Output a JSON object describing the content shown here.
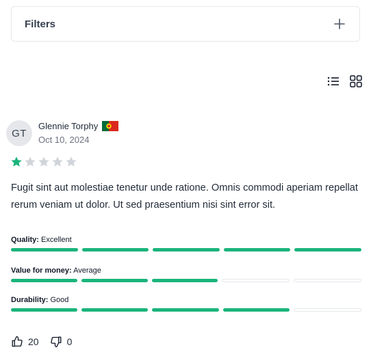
{
  "filters": {
    "label": "Filters",
    "toggle_icon": "plus-icon"
  },
  "view": {
    "list_icon": "list-view-icon",
    "grid_icon": "grid-view-icon"
  },
  "review": {
    "avatar_initials": "GT",
    "author": "Glennie Torphy",
    "country_flag": "portugal-flag-icon",
    "date": "Oct 10, 2024",
    "rating": 1,
    "rating_max": 5,
    "text": "Fugit sint aut molestiae tenetur unde ratione. Omnis commodi aperiam repellat rerum veniam ut dolor. Ut sed praesentium nisi sint error sit.",
    "attributes": [
      {
        "name": "Quality:",
        "value": "Excellent",
        "score": 5,
        "max": 5
      },
      {
        "name": "Value for money:",
        "value": "Average",
        "score": 3,
        "max": 5
      },
      {
        "name": "Durability:",
        "value": "Good",
        "score": 4,
        "max": 5
      }
    ],
    "helpful_count": "20",
    "unhelpful_count": "0"
  },
  "colors": {
    "accent": "#1ab47b",
    "star_empty": "#d1d5db",
    "border": "#e5e7eb"
  }
}
